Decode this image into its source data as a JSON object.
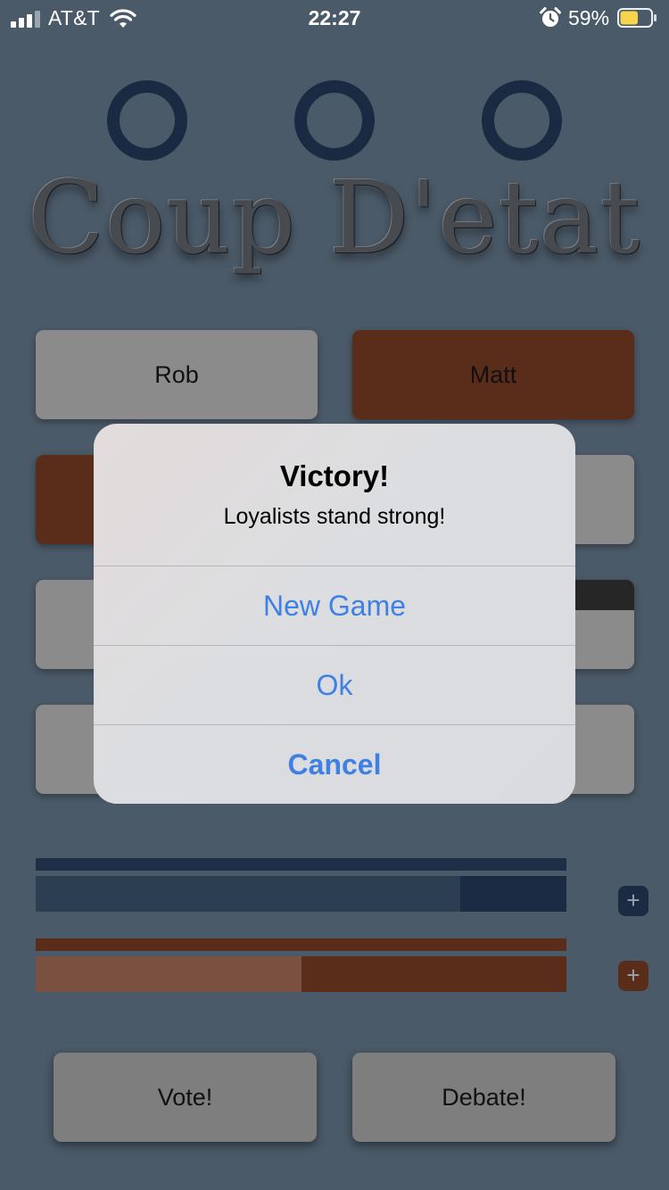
{
  "status_bar": {
    "carrier": "AT&T",
    "time": "22:27",
    "battery_percent": "59%",
    "battery_level": 0.59,
    "icons": [
      "signal-icon",
      "wifi-icon",
      "alarm-icon",
      "battery-icon"
    ]
  },
  "game": {
    "title": "Coup D'etat",
    "players": [
      {
        "label": "Rob",
        "team": "loyalist"
      },
      {
        "label": "Matt",
        "team": "rebel"
      },
      {
        "label": "",
        "team": "rebel"
      },
      {
        "label": "",
        "team": "loyalist"
      },
      {
        "label": "",
        "team": "loyalist"
      },
      {
        "label": "",
        "team": "loyalist"
      },
      {
        "label": "",
        "team": "loyalist"
      },
      {
        "label": "",
        "team": "loyalist"
      }
    ],
    "loyalist_progress": 0.8,
    "rebel_progress": 0.5,
    "plus_label": "+",
    "vote_label": "Vote!",
    "debate_label": "Debate!",
    "colors": {
      "background": "#4b5a68",
      "loyalist": "#1b2b44",
      "rebel": "#5a2c1a",
      "neutral_button": "#8b8b8b"
    }
  },
  "alert": {
    "title": "Victory!",
    "message": "Loyalists stand strong!",
    "buttons": [
      "New Game",
      "Ok",
      "Cancel"
    ],
    "button_color": "#3f80e4"
  }
}
